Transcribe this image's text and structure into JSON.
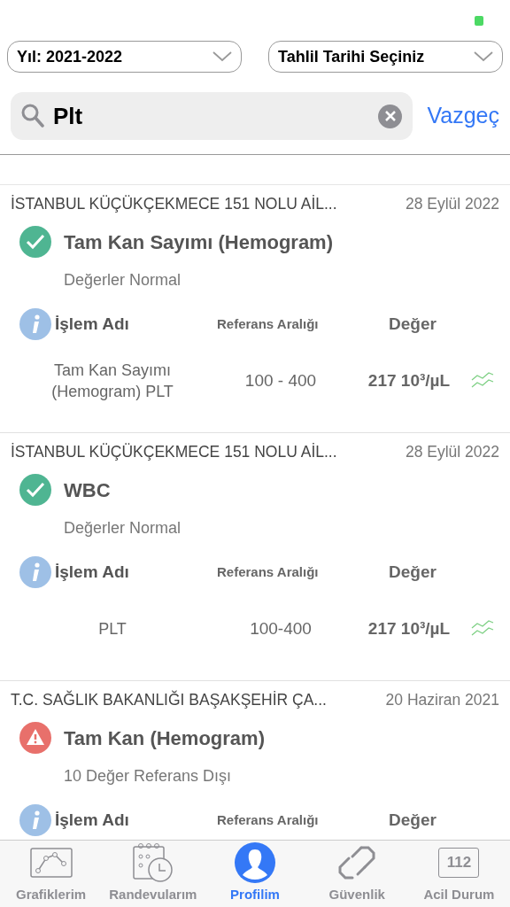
{
  "filters": [
    {
      "label": "Yıl: 2021-2022"
    },
    {
      "label": "Tahlil Tarihi Seçiniz"
    }
  ],
  "search": {
    "value": "Plt",
    "cancel": "Vazgeç"
  },
  "results": [
    {
      "source": "İSTANBUL KÜÇÜKÇEKMECE 151 NOLU AİL...",
      "date": "28 Eylül 2022",
      "kind": "normal",
      "title": "Tam Kan Sayımı (Hemogram)",
      "summary": "Değerler Normal",
      "columns": [
        "İşlem Adı",
        "Referans Aralığı",
        "Değer"
      ],
      "rows": [
        {
          "name": "Tam Kan Sayımı (Hemogram) PLT",
          "range": "100 - 400",
          "value": "217 10³/µL"
        }
      ]
    },
    {
      "source": "İSTANBUL KÜÇÜKÇEKMECE 151 NOLU AİL...",
      "date": "28 Eylül 2022",
      "kind": "normal",
      "title": "WBC",
      "summary": "Değerler Normal",
      "columns": [
        "İşlem Adı",
        "Referans Aralığı",
        "Değer"
      ],
      "rows": [
        {
          "name": "PLT",
          "range": "100-400",
          "value": "217 10³/µL"
        }
      ]
    },
    {
      "source": "T.C. SAĞLIK BAKANLIĞI BAŞAKŞEHİR ÇA...",
      "date": "20 Haziran 2021",
      "kind": "abnormal",
      "title": "Tam Kan (Hemogram)",
      "summary": "10 Değer Referans Dışı",
      "columns": [
        "İşlem Adı",
        "Referans Aralığı",
        "Değer"
      ]
    }
  ],
  "tab_bar": [
    {
      "label": "Grafiklerim",
      "kind": "chart",
      "selected": false
    },
    {
      "label": "Randevularım",
      "kind": "calendar",
      "selected": false
    },
    {
      "label": "Profilim",
      "kind": "profile",
      "selected": true
    },
    {
      "label": "Güvenlik",
      "kind": "link",
      "selected": false
    },
    {
      "label": "Acil Durum",
      "kind": "emergency",
      "badge": "112",
      "selected": false
    }
  ]
}
